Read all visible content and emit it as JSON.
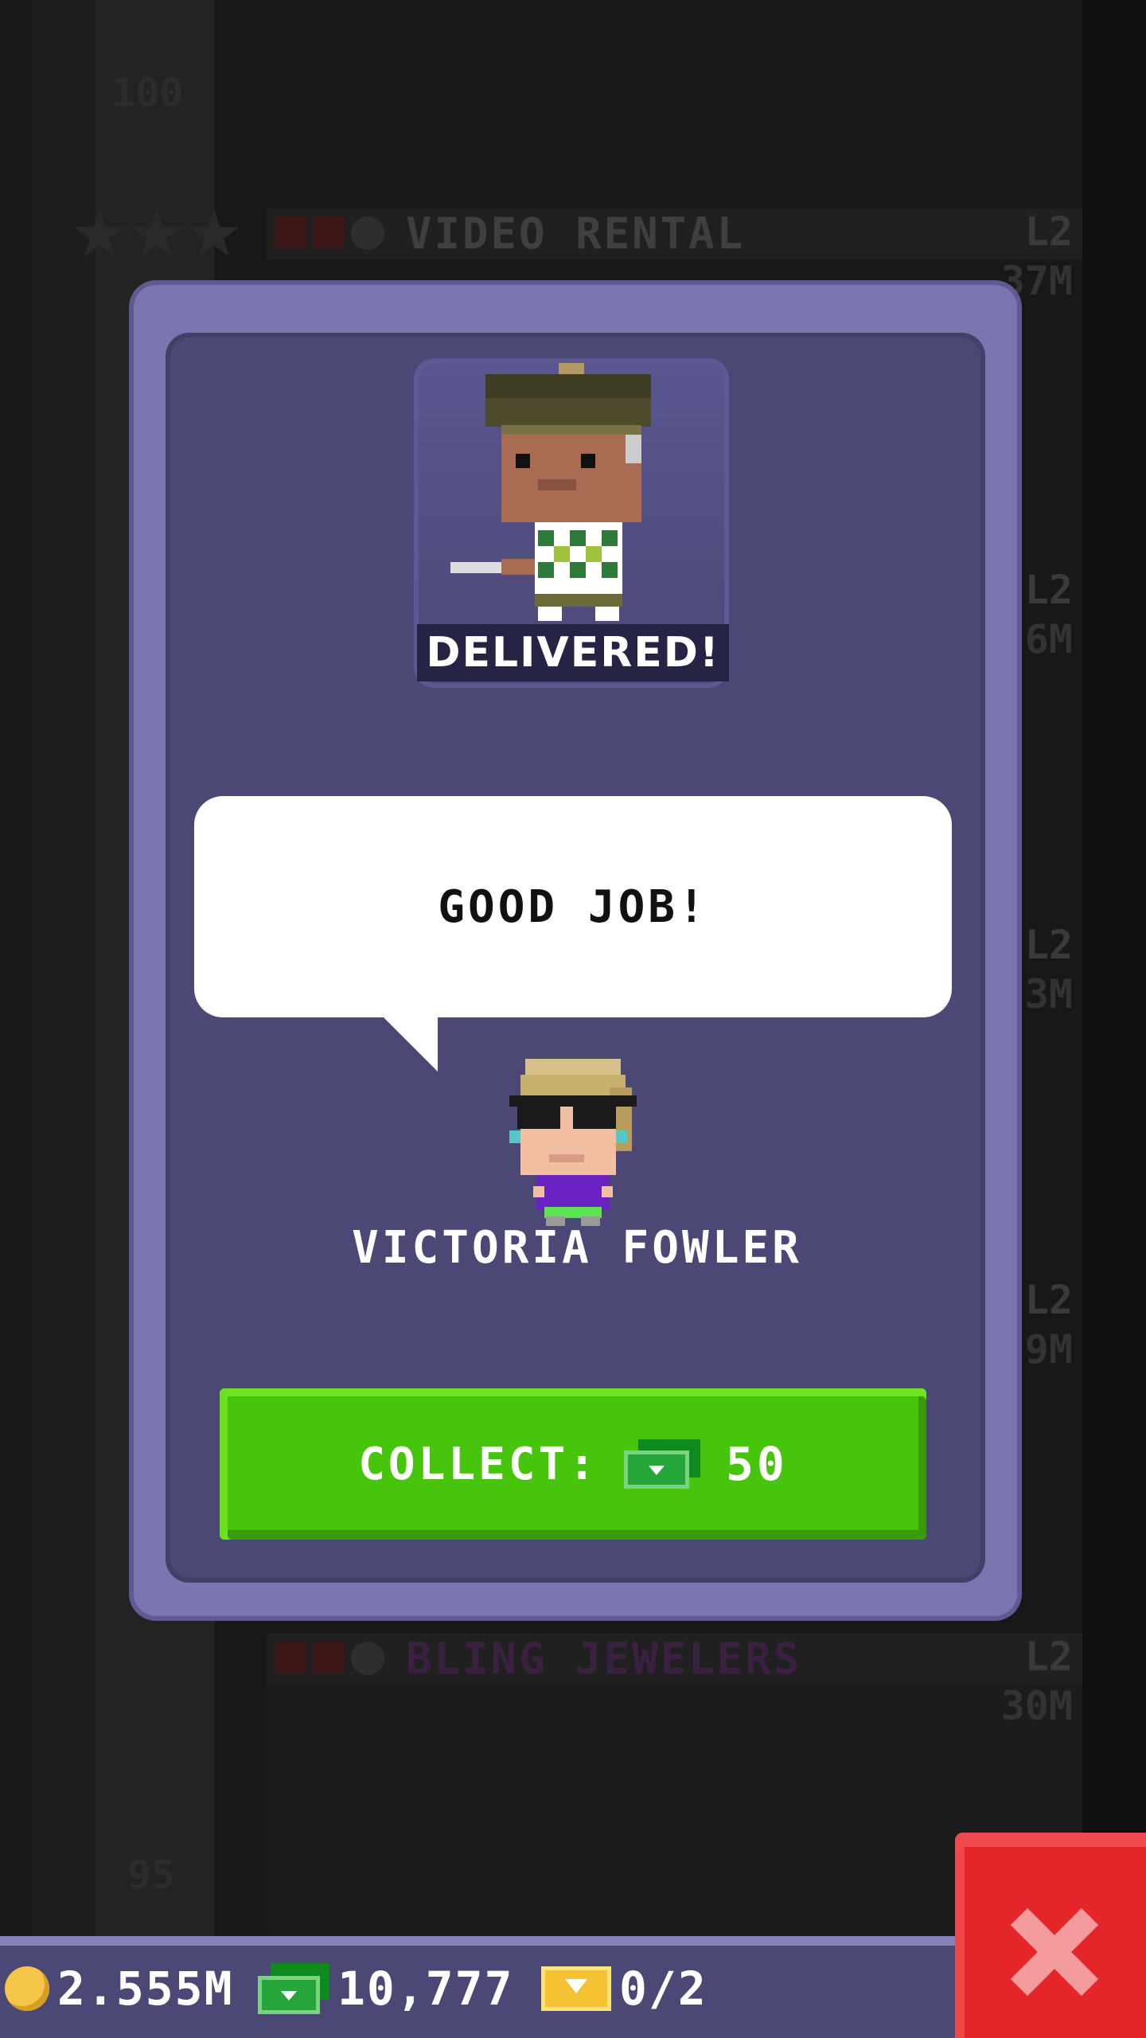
{
  "background": {
    "floor_numbers": [
      "100",
      "95"
    ],
    "floors": [
      {
        "name": "VIDEO RENTAL",
        "level": "L2",
        "price": "37M",
        "name_color": "#3f3f3f"
      },
      {
        "name": "BLING JEWELERS",
        "level": "L2",
        "price": "30M",
        "name_color": "#3a2140"
      }
    ],
    "partial_levels": [
      "L2",
      "L2",
      "L2",
      "L2"
    ],
    "partial_prices": [
      "6M",
      "3M",
      "9M"
    ]
  },
  "modal": {
    "status_banner": "DELIVERED!",
    "speech_text": "GOOD JOB!",
    "sender_name": "VICTORIA FOWLER",
    "collect_label": "COLLECT:",
    "collect_amount": "50",
    "collect_currency_icon": "tower-bux-icon"
  },
  "bottom_bar": {
    "coins": "2.555M",
    "bux": "10,777",
    "tickets": "0/2"
  },
  "colors": {
    "modal_frame": "#7a75ae",
    "modal_body": "#4c4875",
    "collect_button": "#47c40c",
    "close_button": "#e4262b"
  },
  "icons": [
    "coin-icon",
    "tower-bux-icon",
    "golden-ticket-icon",
    "close-icon",
    "star-icon",
    "clock-icon"
  ]
}
